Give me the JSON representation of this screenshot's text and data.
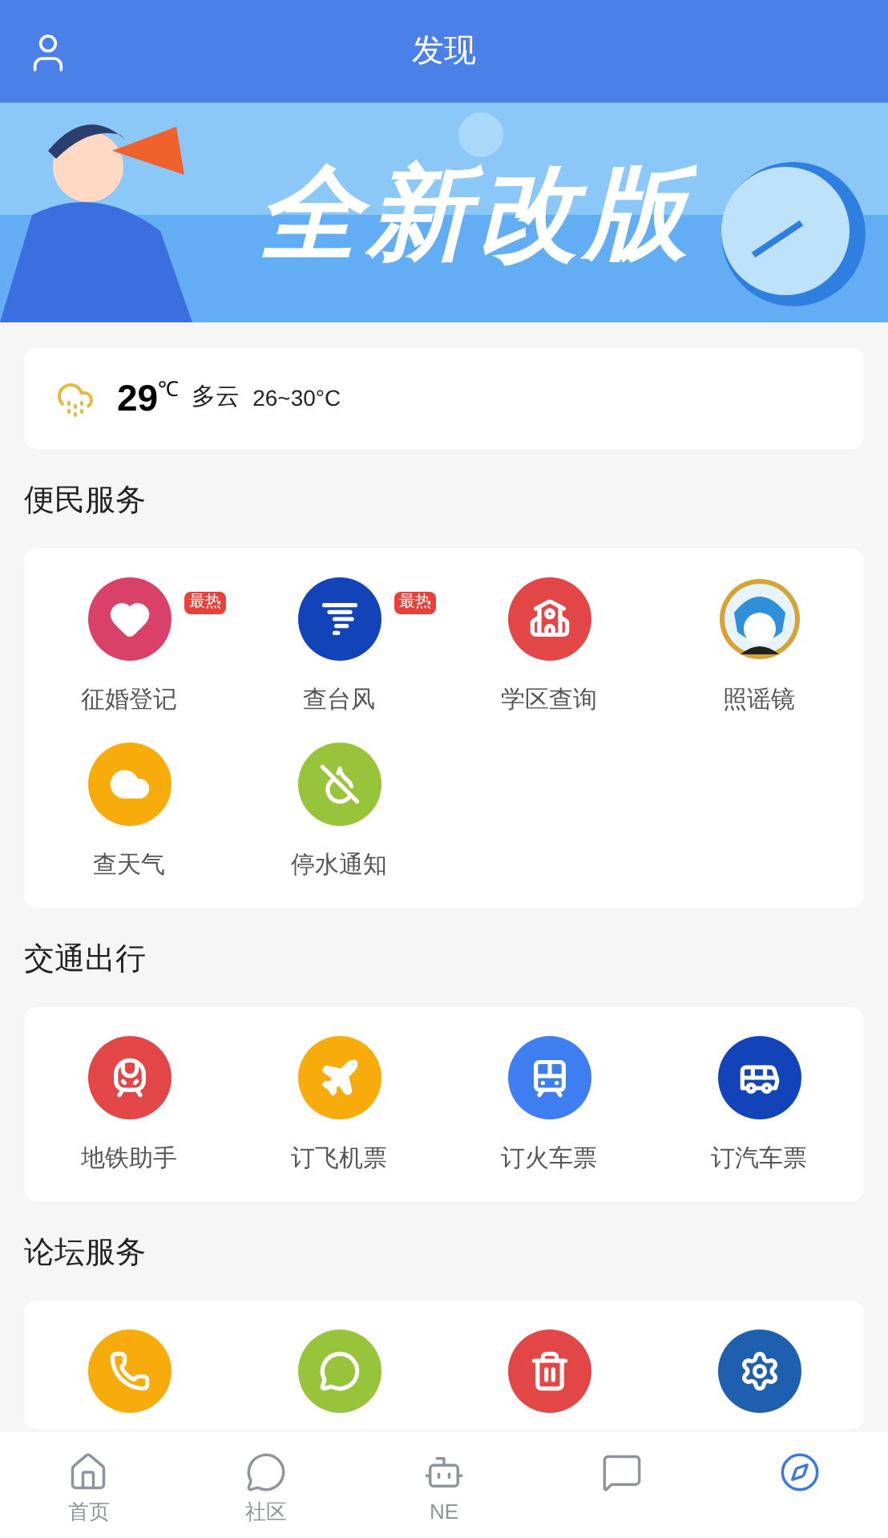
{
  "header": {
    "title": "发现"
  },
  "banner": {
    "title": "全新改版"
  },
  "weather": {
    "temp": "29",
    "unit": "℃",
    "condition": "多云",
    "range": "26~30°C"
  },
  "sections": [
    {
      "title": "便民服务",
      "items": [
        {
          "kind": "heart",
          "color": "#d9406a",
          "label": "征婚登记",
          "badge": "最热"
        },
        {
          "kind": "typhoon",
          "color": "#1343b8",
          "label": "查台风",
          "badge": "最热"
        },
        {
          "kind": "school",
          "color": "#e24646",
          "label": "学区查询"
        },
        {
          "kind": "avatar",
          "color": "#d4a437",
          "label": "照谣镜"
        },
        {
          "kind": "cloud",
          "color": "#f7ac0b",
          "label": "查天气"
        },
        {
          "kind": "water",
          "color": "#98c43c",
          "label": "停水通知"
        }
      ]
    },
    {
      "title": "交通出行",
      "items": [
        {
          "kind": "metro",
          "color": "#e24646",
          "label": "地铁助手"
        },
        {
          "kind": "plane",
          "color": "#f7ac0b",
          "label": "订飞机票"
        },
        {
          "kind": "train",
          "color": "#3f7ef0",
          "label": "订火车票"
        },
        {
          "kind": "bus",
          "color": "#1343b8",
          "label": "订汽车票"
        }
      ]
    },
    {
      "title": "论坛服务",
      "items": [
        {
          "kind": "phone",
          "color": "#f7ac0b"
        },
        {
          "kind": "chat",
          "color": "#98c43c"
        },
        {
          "kind": "trash",
          "color": "#e24646"
        },
        {
          "kind": "gear",
          "color": "#1e5fb0"
        }
      ]
    }
  ],
  "tabbar": [
    {
      "kind": "home",
      "label": "首页",
      "selected": false
    },
    {
      "kind": "community",
      "label": "社区",
      "selected": false
    },
    {
      "kind": "robot",
      "label": "NE",
      "selected": false
    },
    {
      "kind": "message",
      "selected": false
    },
    {
      "kind": "discover",
      "selected": true
    }
  ]
}
